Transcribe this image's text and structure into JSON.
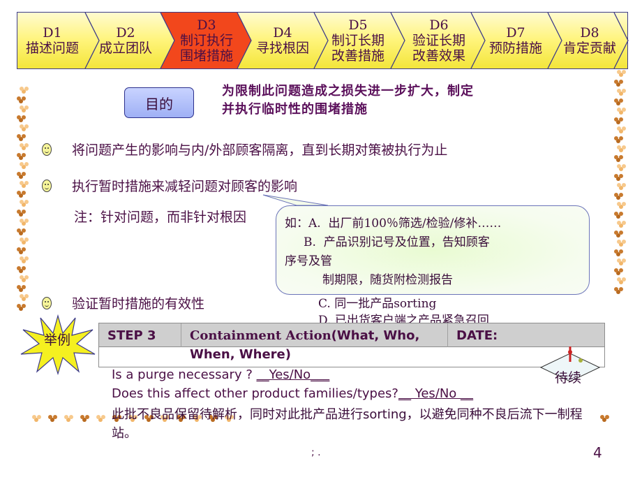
{
  "steps": [
    {
      "code": "D1",
      "lines": [
        "描述问题"
      ],
      "active": false
    },
    {
      "code": "D2",
      "lines": [
        "成立团队"
      ],
      "active": false
    },
    {
      "code": "D3",
      "lines": [
        "制订执行",
        "围堵措施"
      ],
      "active": true
    },
    {
      "code": "D4",
      "lines": [
        "寻找根因"
      ],
      "active": false
    },
    {
      "code": "D5",
      "lines": [
        "制订长期",
        "改善措施"
      ],
      "active": false
    },
    {
      "code": "D6",
      "lines": [
        "验证长期",
        "改善效果"
      ],
      "active": false
    },
    {
      "code": "D7",
      "lines": [
        "预防措施"
      ],
      "active": false
    },
    {
      "code": "D8",
      "lines": [
        "肯定贡献"
      ],
      "active": false
    }
  ],
  "colors": {
    "active_step": "#f2471c",
    "step_fill": "#fff47a",
    "text": "#4a0f45",
    "purpose_button": "#9fb0f5",
    "star": "#f5f020"
  },
  "purpose": {
    "label": "目的",
    "text_line1": "为限制此问题造成之损失进一步扩大，制定",
    "text_line2": "并执行临时性的围堵措施"
  },
  "bullets": [
    {
      "icon": "smiley-icon",
      "text": "将问题产生的影响与内/外部顾客隔离，直到长期对策被执行为止"
    },
    {
      "icon": "smiley-icon",
      "text": "执行暂时措施来减轻问题对顾客的影响"
    },
    {
      "icon": "smiley-icon",
      "text": "验证暂时措施的有效性"
    }
  ],
  "note": "注：针对问题，而非针对根因",
  "callout": {
    "line1": "如：A.  出厂前100％筛选/检验/修补……",
    "line2": "     B.  产品识别记号及位置，告知顾客",
    "line3": "序号及管",
    "line4": "          制期限，随货附检测报告",
    "line5": "C.  同一批产品sorting",
    "line6": "D.  已出货客户端之产品紧急召回"
  },
  "example_label": "举例",
  "table": {
    "step": "STEP 3",
    "action_serif": "Containment Action",
    "action_sans": "(What, Who,",
    "action_wrap": "When, Where)",
    "date": "DATE:"
  },
  "questions": {
    "q1_text": "Is a purge necessary ? ",
    "q1_answer": "__Yes/No___",
    "q2_text": "Does this affect other product families/types?",
    "q2_answer": "__ Yes/No __"
  },
  "action_text": "此批不良品保留待解析，同时对此批产品进行sorting，以避免同种不良后流下一制程站。",
  "pending_label": "待续",
  "footer_mark": "; .",
  "page_number": "4"
}
